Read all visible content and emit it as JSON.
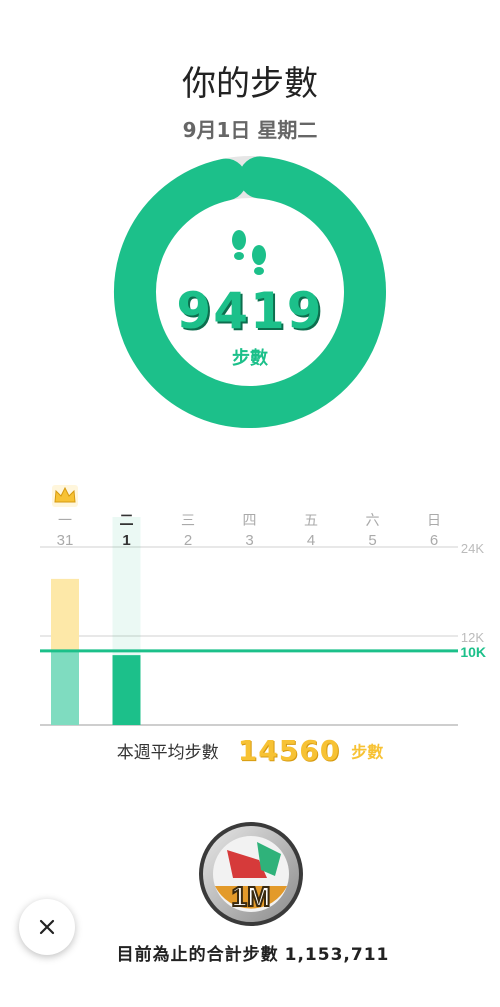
{
  "header": {
    "title": "你的步數",
    "date": "9月1日 星期二"
  },
  "today": {
    "steps": "9419",
    "unit": "步數",
    "goal_progress": 0.98
  },
  "colors": {
    "accent": "#1cc08a",
    "accent_dark": "#0d6e4e",
    "gold": "#f7c234",
    "light_green": "#7fdcc0",
    "pale_yellow": "#fde8a8"
  },
  "chart_data": {
    "type": "bar",
    "categories": [
      {
        "weekday": "一",
        "day": "31"
      },
      {
        "weekday": "二",
        "day": "1"
      },
      {
        "weekday": "三",
        "day": "2"
      },
      {
        "weekday": "四",
        "day": "3"
      },
      {
        "weekday": "五",
        "day": "4"
      },
      {
        "weekday": "六",
        "day": "5"
      },
      {
        "weekday": "日",
        "day": "6"
      }
    ],
    "values": [
      19700,
      9419,
      null,
      null,
      null,
      null,
      null
    ],
    "selected_index": 1,
    "crown_index": 0,
    "ylim": [
      0,
      24000
    ],
    "gridlines": [
      {
        "value": 24000,
        "label": "24K"
      },
      {
        "value": 12000,
        "label": "12K"
      }
    ],
    "goal": {
      "value": 10000,
      "label": "10K"
    }
  },
  "weekly_average": {
    "label": "本週平均步數",
    "value": "14560",
    "unit": "步數"
  },
  "total": {
    "label": "目前為止的合計步數",
    "value": "1,153,711"
  },
  "medal": {
    "text": "1M"
  },
  "icons": {
    "close": "close-icon",
    "footprints": "footprints-icon",
    "crown": "crown-icon",
    "medal": "shoe-medal-icon"
  }
}
